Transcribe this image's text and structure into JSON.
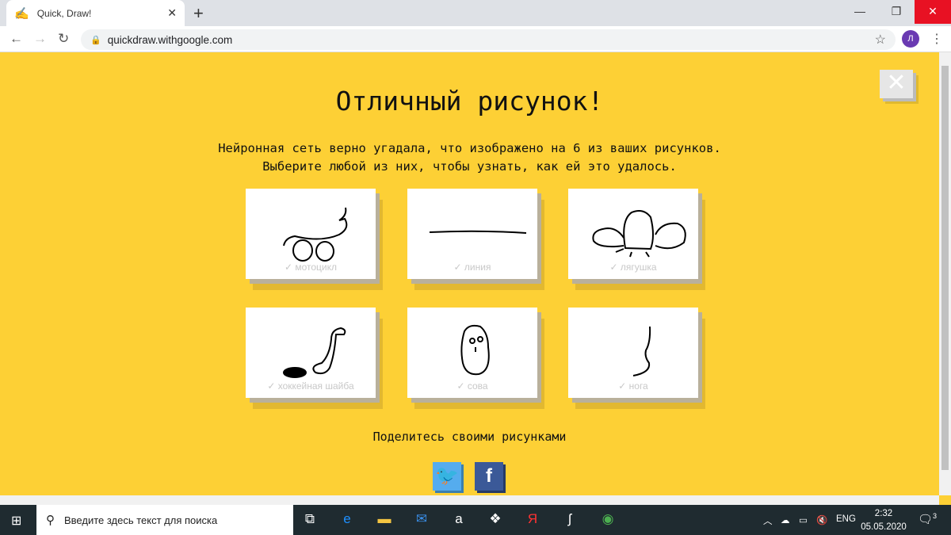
{
  "browser": {
    "tab_title": "Quick, Draw!",
    "url": "quickdraw.withgoogle.com",
    "profile_initial": "Л"
  },
  "page": {
    "title": "Отличный рисунок!",
    "subtitle_line1": "Нейронная сеть верно угадала, что изображено на 6 из ваших рисунков.",
    "subtitle_line2": "Выберите любой из них, чтобы узнать, как ей это удалось.",
    "drawings": [
      {
        "label": "✓ мотоцикл"
      },
      {
        "label": "✓ линия"
      },
      {
        "label": "✓ лягушка"
      },
      {
        "label": "✓ хоккейная шайба"
      },
      {
        "label": "✓ сова"
      },
      {
        "label": "✓ нога"
      }
    ],
    "share_label": "Поделитесь своими рисунками",
    "accent_color": "#fdd035"
  },
  "taskbar": {
    "search_placeholder": "Введите здесь текст для поиска",
    "lang": "ENG",
    "time": "2:32",
    "date": "05.05.2020",
    "notifications": "3"
  }
}
